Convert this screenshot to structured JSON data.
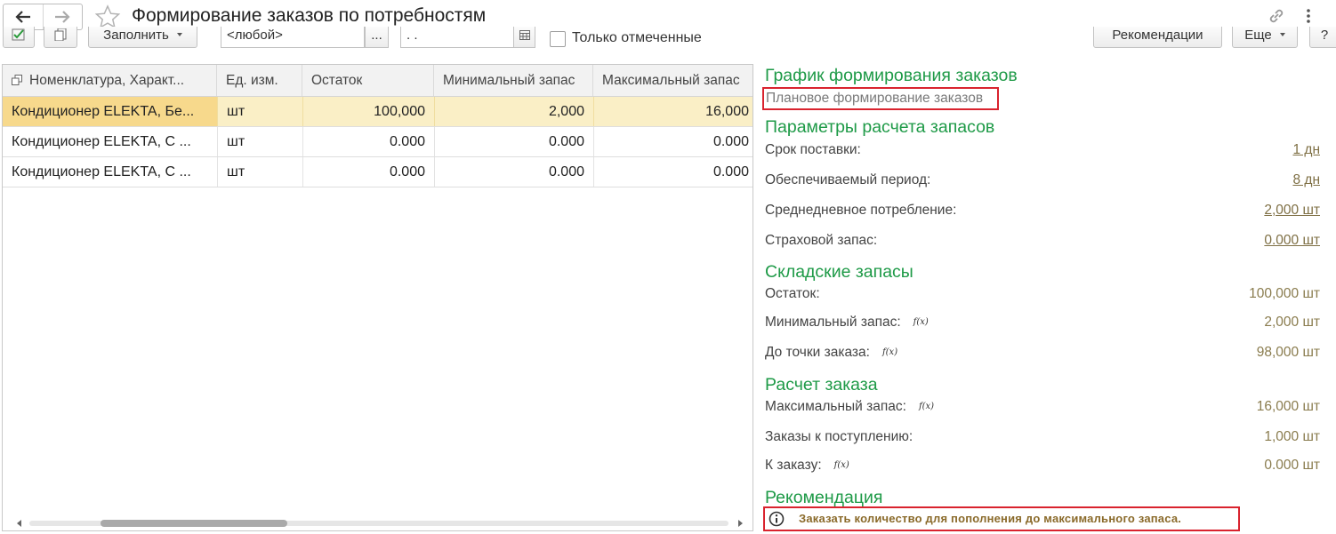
{
  "window": {
    "title": "Формирование заказов по потребностям"
  },
  "toolbar": {
    "fill_button": "Заполнить",
    "filter_value": "<любой>",
    "filter_more": "...",
    "date_value": ". .",
    "only_marked_label": "Только отмеченные",
    "recommendations_button": "Рекомендации",
    "more_button": "Еще",
    "help_button": "?"
  },
  "table": {
    "columns": [
      "Номенклатура, Характ...",
      "Ед. изм.",
      "Остаток",
      "Минимальный запас",
      "Максимальный запас"
    ],
    "rows": [
      {
        "item": "Кондиционер ELEKTA, Бе...",
        "unit": "шт",
        "stock": "100,000",
        "min": "2,000",
        "max": "16,000"
      },
      {
        "item": "Кондиционер ELEKTA, С ...",
        "unit": "шт",
        "stock": "0.000",
        "min": "0.000",
        "max": "0.000"
      },
      {
        "item": "Кондиционер ELEKTA, С ...",
        "unit": "шт",
        "stock": "0.000",
        "min": "0.000",
        "max": "0.000"
      }
    ],
    "selected_row": 0
  },
  "panel": {
    "schedule_title": "График формирования заказов",
    "schedule_value": "Плановое формирование заказов",
    "params_title": "Параметры расчета запасов",
    "params": [
      {
        "label": "Срок поставки:",
        "value": "1 дн"
      },
      {
        "label": "Обеспечиваемый период:",
        "value": "8 дн"
      },
      {
        "label": "Среднедневное потребление:",
        "value": "2,000 шт"
      },
      {
        "label": "Страховой запас:",
        "value": "0.000 шт"
      }
    ],
    "stock_title": "Складские запасы",
    "stock": [
      {
        "label": "Остаток:",
        "value": "100,000 шт",
        "fx": ""
      },
      {
        "label": "Минимальный запас:",
        "value": "2,000 шт",
        "fx": "f(x)"
      },
      {
        "label": "До точки заказа:",
        "value": "98,000 шт",
        "fx": "f(x)"
      }
    ],
    "calc_title": "Расчет заказа",
    "calc": [
      {
        "label": "Максимальный запас:",
        "value": "16,000 шт",
        "fx": "f(x)"
      },
      {
        "label": "Заказы к поступлению:",
        "value": "1,000 шт",
        "fx": ""
      },
      {
        "label": "К заказу:",
        "value": "0.000 шт",
        "fx": "f(x)"
      }
    ],
    "rec_title": "Рекомендация",
    "rec_text": "Заказать количество для пополнения до максимального запаса."
  },
  "colors": {
    "section_green": "#1e9a47",
    "highlight_red": "#d9232e",
    "selected_row": "#faefc6",
    "value_brown": "#8a7c4e"
  }
}
